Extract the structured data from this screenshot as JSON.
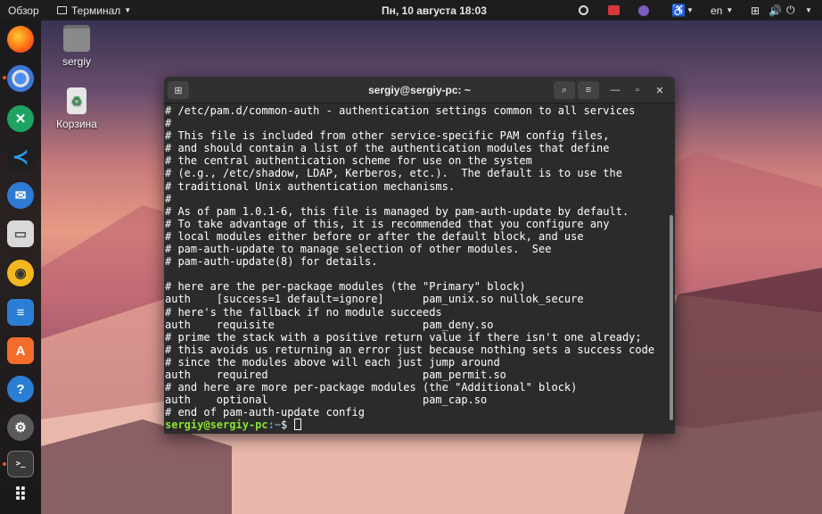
{
  "topbar": {
    "activities": "Обзор",
    "app_menu": "Терминал",
    "clock": "Пн, 10 августа  18:03",
    "lang": "en"
  },
  "desktop": {
    "home_label": "sergiy",
    "trash_label": "Корзина"
  },
  "terminal": {
    "title": "sergiy@sergiy-pc: ~",
    "lines": [
      "# /etc/pam.d/common-auth - authentication settings common to all services",
      "#",
      "# This file is included from other service-specific PAM config files,",
      "# and should contain a list of the authentication modules that define",
      "# the central authentication scheme for use on the system",
      "# (e.g., /etc/shadow, LDAP, Kerberos, etc.).  The default is to use the",
      "# traditional Unix authentication mechanisms.",
      "#",
      "# As of pam 1.0.1-6, this file is managed by pam-auth-update by default.",
      "# To take advantage of this, it is recommended that you configure any",
      "# local modules either before or after the default block, and use",
      "# pam-auth-update to manage selection of other modules.  See",
      "# pam-auth-update(8) for details.",
      "",
      "# here are the per-package modules (the \"Primary\" block)",
      "auth    [success=1 default=ignore]      pam_unix.so nullok_secure",
      "# here's the fallback if no module succeeds",
      "auth    requisite                       pam_deny.so",
      "# prime the stack with a positive return value if there isn't one already;",
      "# this avoids us returning an error just because nothing sets a success code",
      "# since the modules above will each just jump around",
      "auth    required                        pam_permit.so",
      "# and here are more per-package modules (the \"Additional\" block)",
      "auth    optional                        pam_cap.so",
      "# end of pam-auth-update config"
    ],
    "prompt_user": "sergiy@sergiy-pc",
    "prompt_path": ":~",
    "prompt_symbol": "$ "
  }
}
